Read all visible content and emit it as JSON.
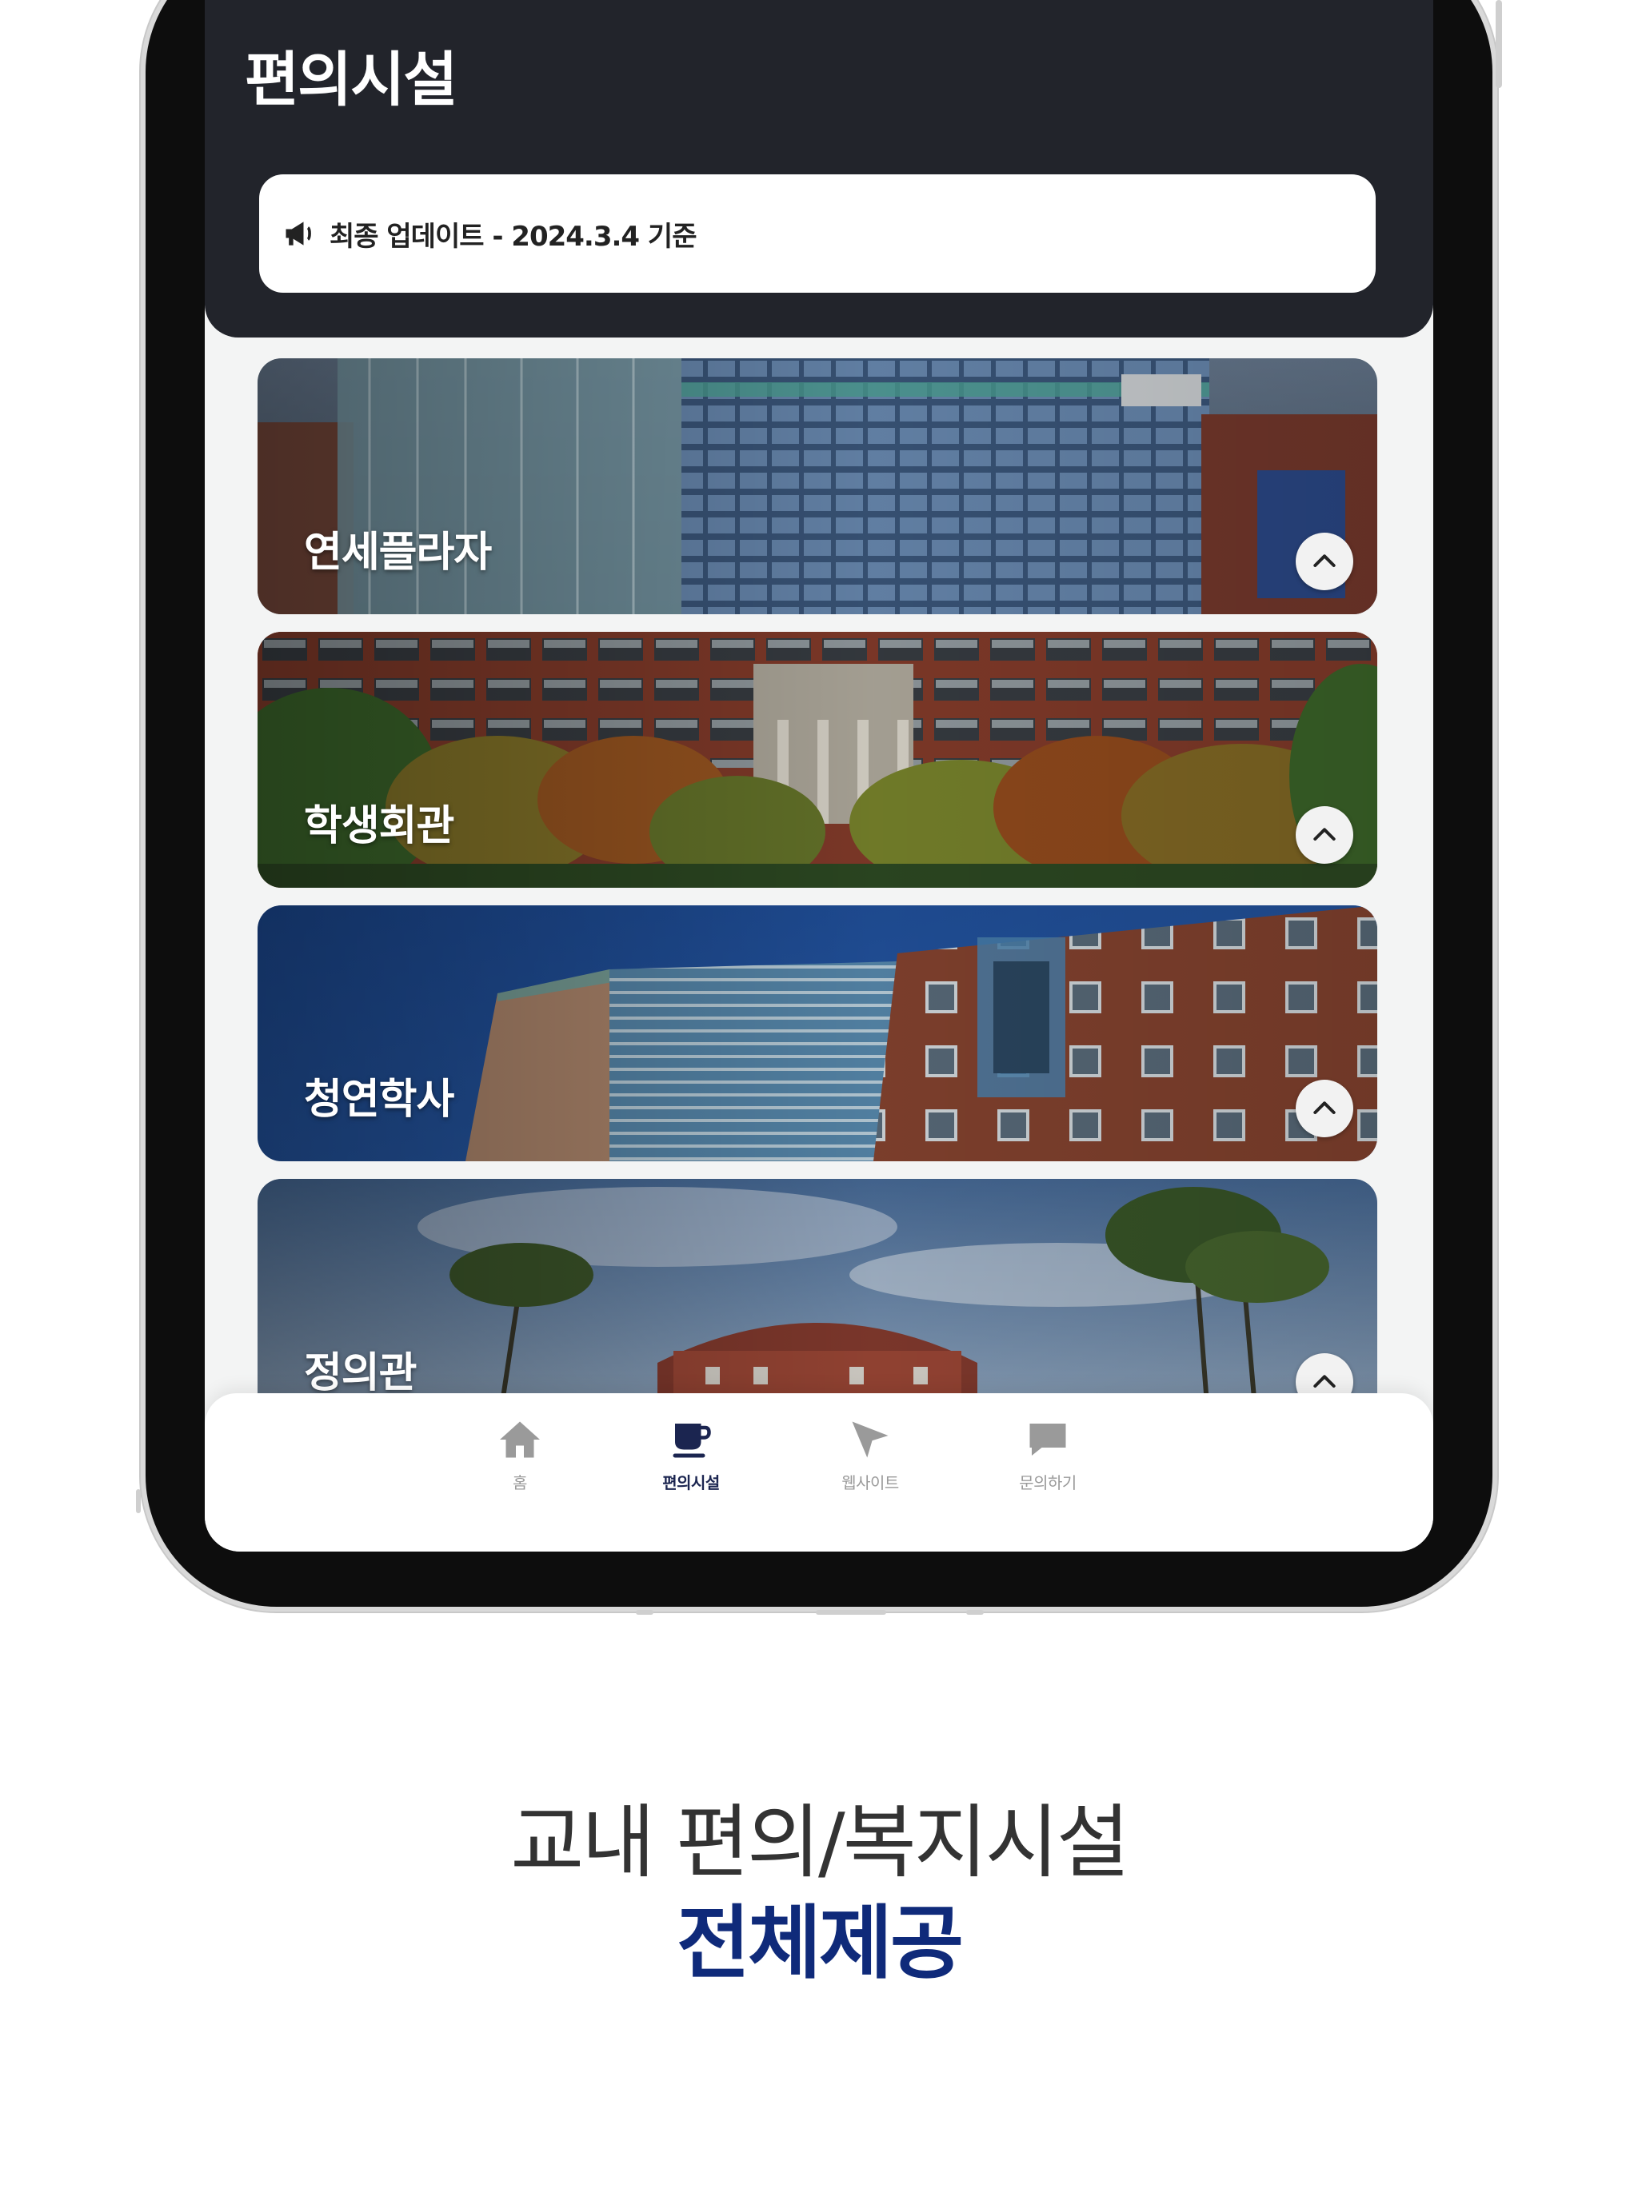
{
  "header": {
    "title": "편의시설",
    "notice": {
      "icon": "megaphone-icon",
      "text": "최종 업데이트 - 2024.3.4 기준"
    }
  },
  "facilities": [
    {
      "name": "연세플라자",
      "toggle_icon": "chevron-up-icon"
    },
    {
      "name": "학생회관",
      "toggle_icon": "chevron-up-icon"
    },
    {
      "name": "청연학사",
      "toggle_icon": "chevron-up-icon"
    },
    {
      "name": "정의관",
      "toggle_icon": "chevron-up-icon"
    }
  ],
  "bottom_nav": {
    "items": [
      {
        "label": "홈",
        "icon": "home-icon",
        "active": false
      },
      {
        "label": "편의시설",
        "icon": "cup-icon",
        "active": true
      },
      {
        "label": "웹사이트",
        "icon": "cursor-icon",
        "active": false
      },
      {
        "label": "문의하기",
        "icon": "chat-icon",
        "active": false
      }
    ]
  },
  "caption": {
    "line1": "교내 편의/복지시설",
    "line2": "전체제공"
  },
  "colors": {
    "header_bg": "#22242b",
    "accent": "#0f2a7a",
    "nav_active": "#1b2550",
    "nav_inactive": "#9a9a9a"
  }
}
